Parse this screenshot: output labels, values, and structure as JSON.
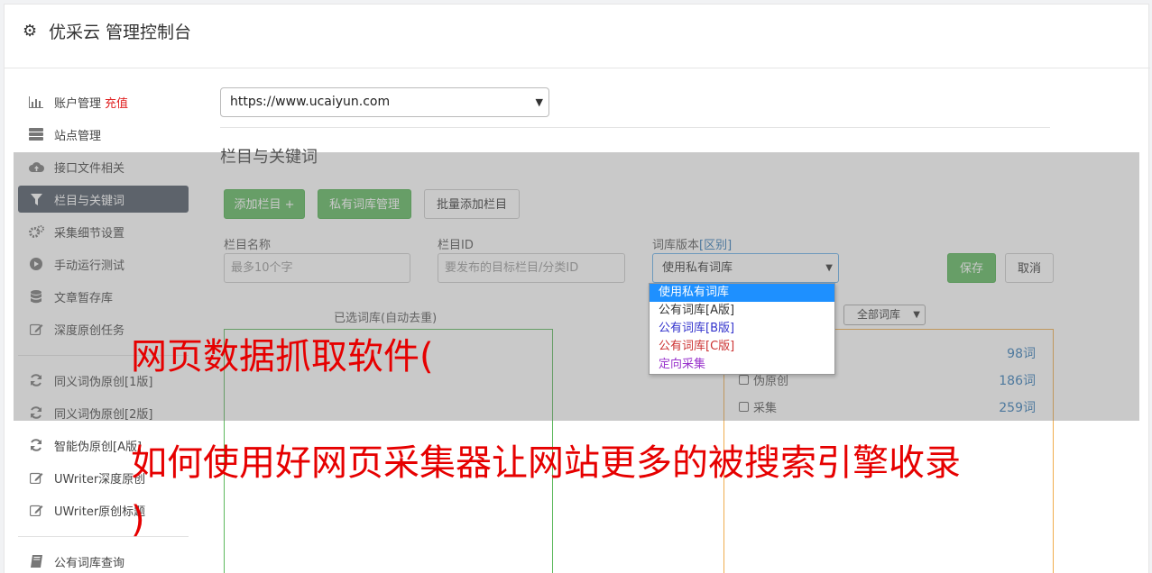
{
  "header": {
    "title": "优采云 管理控制台",
    "icon": "gear-icon"
  },
  "sidebar": {
    "items": [
      {
        "label": "账户管理",
        "badge": "充值",
        "icon": "bar-chart-icon"
      },
      {
        "label": "站点管理",
        "icon": "server-icon"
      },
      {
        "label": "接口文件相关",
        "icon": "cloud-upload-icon"
      },
      {
        "label": "栏目与关键词",
        "icon": "filter-icon",
        "active": true
      },
      {
        "label": "采集细节设置",
        "icon": "cogs-icon"
      },
      {
        "label": "手动运行测试",
        "icon": "play-circle-icon"
      },
      {
        "label": "文章暂存库",
        "icon": "database-icon"
      },
      {
        "label": "深度原创任务",
        "icon": "edit-icon"
      },
      {
        "label": "同义词伪原创[1版]",
        "icon": "refresh-icon"
      },
      {
        "label": "同义词伪原创[2版]",
        "icon": "refresh-icon"
      },
      {
        "label": "智能伪原创[A版]",
        "icon": "refresh-icon"
      },
      {
        "label": "UWriter深度原创",
        "icon": "edit-icon"
      },
      {
        "label": "UWriter原创标题",
        "icon": "edit-icon"
      },
      {
        "label": "公有词库查询",
        "icon": "book-icon"
      }
    ]
  },
  "main": {
    "site_select_value": "https://www.ucaiyun.com",
    "section_title": "栏目与关键词",
    "buttons": {
      "add_column": "添加栏目 +",
      "private_lib": "私有词库管理",
      "batch_add": "批量添加栏目",
      "save": "保存",
      "cancel": "取消"
    },
    "form": {
      "name_label": "栏目名称",
      "name_placeholder": "最多10个字",
      "id_label": "栏目ID",
      "id_placeholder": "要发布的目标栏目/分类ID",
      "version_label": "词库版本",
      "version_link": "[区别]",
      "version_value": "使用私有词库"
    },
    "dropdown_options": [
      {
        "label": "使用私有词库",
        "color": "#ffffff"
      },
      {
        "label": "公有词库[A版]",
        "color": "#333333"
      },
      {
        "label": "公有词库[B版]",
        "color": "#3333cc"
      },
      {
        "label": "公有词库[C版]",
        "color": "#cc3333"
      },
      {
        "label": "定向采集",
        "color": "#9933cc"
      }
    ],
    "selected_libs_title": "已选词库(自动去重)",
    "all_libs_select": "全部词库",
    "lib_rows": [
      {
        "label": "",
        "count": "98词"
      },
      {
        "label": "伪原创",
        "count": "186词"
      },
      {
        "label": "采集",
        "count": "259词"
      }
    ]
  },
  "overlay_text": {
    "line1": "网页数据抓取软件(",
    "line2": "如何使用好网页采集器让网站更多的被搜索引擎收录",
    "line3": ")"
  }
}
